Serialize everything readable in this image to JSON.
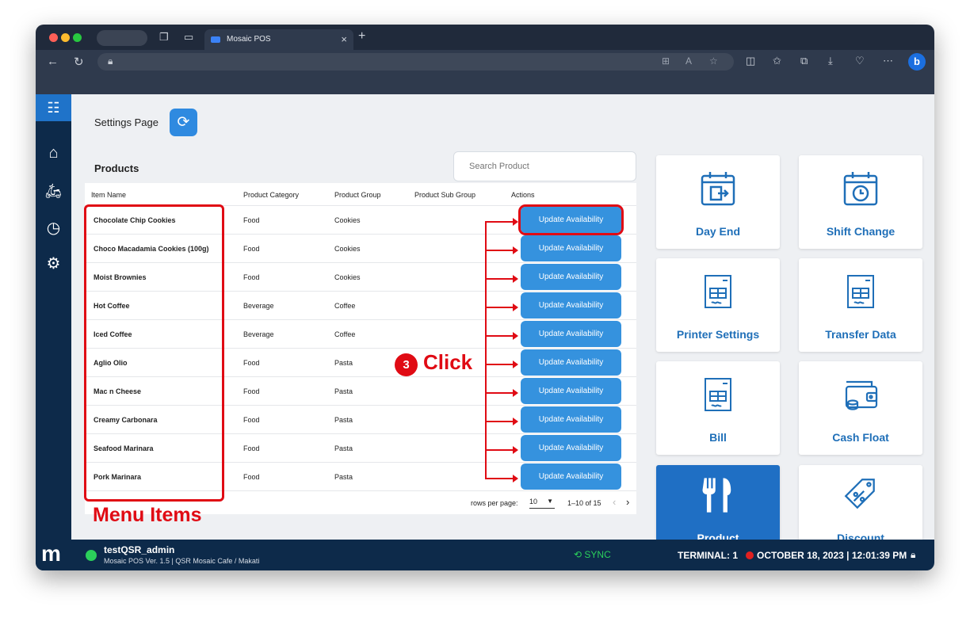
{
  "browser": {
    "tab_title": "Mosaic POS",
    "tab_close": "×",
    "new_tab": "+"
  },
  "app": {
    "settings_title": "Settings Page",
    "products_title": "Products",
    "search_placeholder": "Search Product",
    "columns": [
      "Item Name",
      "Product Category",
      "Product Group",
      "Product Sub Group",
      "Actions"
    ],
    "rows": [
      {
        "name": "Chocolate Chip Cookies",
        "category": "Food",
        "group": "Cookies",
        "action": "Update Availability"
      },
      {
        "name": "Choco Macadamia Cookies (100g)",
        "category": "Food",
        "group": "Cookies",
        "action": "Update Availability"
      },
      {
        "name": "Moist Brownies",
        "category": "Food",
        "group": "Cookies",
        "action": "Update Availability"
      },
      {
        "name": "Hot Coffee",
        "category": "Beverage",
        "group": "Coffee",
        "action": "Update Availability"
      },
      {
        "name": "Iced Coffee",
        "category": "Beverage",
        "group": "Coffee",
        "action": "Update Availability"
      },
      {
        "name": "Aglio Olio",
        "category": "Food",
        "group": "Pasta",
        "action": "Update Availability"
      },
      {
        "name": "Mac n Cheese",
        "category": "Food",
        "group": "Pasta",
        "action": "Update Availability"
      },
      {
        "name": "Creamy Carbonara",
        "category": "Food",
        "group": "Pasta",
        "action": "Update Availability"
      },
      {
        "name": "Seafood Marinara",
        "category": "Food",
        "group": "Pasta",
        "action": "Update Availability"
      },
      {
        "name": "Pork Marinara",
        "category": "Food",
        "group": "Pasta",
        "action": "Update Availability"
      }
    ],
    "pagination": {
      "rows_per_page_label": "rows per page:",
      "rows_per_page_value": "10",
      "range": "1–10 of 15"
    },
    "cards": [
      {
        "label": "Day End",
        "icon": "calendar-exit-icon"
      },
      {
        "label": "Shift Change",
        "icon": "calendar-clock-icon"
      },
      {
        "label": "Printer Settings",
        "icon": "receipt-icon"
      },
      {
        "label": "Transfer Data",
        "icon": "receipt-icon"
      },
      {
        "label": "Bill",
        "icon": "receipt-icon"
      },
      {
        "label": "Cash Float",
        "icon": "wallet-icon"
      },
      {
        "label": "Product",
        "icon": "fork-knife-icon"
      },
      {
        "label": "Discount",
        "icon": "discount-tag-icon"
      }
    ],
    "footer": {
      "logo": "m",
      "username": "testQSR_admin",
      "version": "Mosaic POS Ver. 1.5 | QSR Mosaic Cafe / Makati",
      "sync": "SYNC",
      "terminal": "TERMINAL: 1",
      "datetime": "OCTOBER 18, 2023 | 12:01:39 PM"
    }
  },
  "annotations": {
    "step_number": "3",
    "click_label": "Click",
    "menu_items_label": "Menu Items",
    "color": "#e00b14"
  },
  "colors": {
    "primary_button": "#3592de",
    "sidebar": "#0d2a4a",
    "accent": "#1f6fb8",
    "online": "#2bcf5b"
  }
}
